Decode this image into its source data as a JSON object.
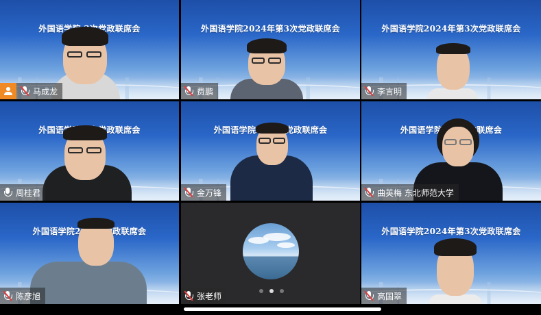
{
  "meeting": {
    "banner_full": "外国语学院2024年第3次党政联席会",
    "banner_partial": "外国语学院20  3次党政联席会",
    "banner_partial2": "外国语学院      3次党政联席会"
  },
  "participants": [
    {
      "name": "马成龙",
      "host": true,
      "mic": "muted",
      "shirt": "#dcdcdc"
    },
    {
      "name": "费鹏",
      "host": false,
      "mic": "muted",
      "shirt": "#5b6470"
    },
    {
      "name": "李言明",
      "host": false,
      "mic": "muted",
      "shirt": "#e8e8e8"
    },
    {
      "name": "周桂君",
      "host": false,
      "mic": "on",
      "shirt": "#1e2022"
    },
    {
      "name": "金万锋",
      "host": false,
      "mic": "muted",
      "shirt": "#1d2a45"
    },
    {
      "name": "曲英梅  东北师范大学",
      "host": false,
      "mic": "muted",
      "shirt": "#14161b"
    },
    {
      "name": "陈彦旭",
      "host": false,
      "mic": "muted",
      "shirt": "#6c7e8e"
    },
    {
      "name": "张老师",
      "host": false,
      "mic": "muted",
      "avatar": "sky-sea-avatar"
    },
    {
      "name": "高国翠",
      "host": false,
      "mic": "muted",
      "shirt": "#ececec"
    }
  ],
  "pagination": {
    "pages": 3,
    "current": 2
  },
  "icons": {
    "host": "person-icon",
    "mic": "microphone-icon"
  },
  "colors": {
    "host_badge": "#f08a24",
    "muted_slash": "#e23b3b"
  }
}
